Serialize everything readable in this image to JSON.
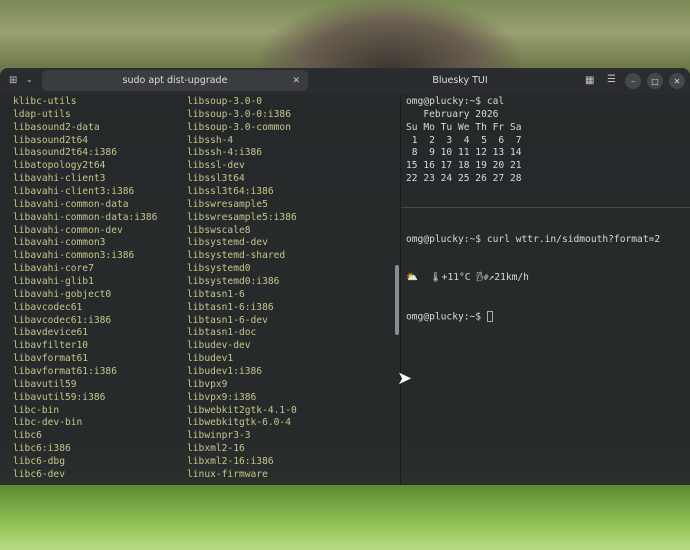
{
  "window": {
    "tab_title": "sudo apt dist-upgrade",
    "title": "Bluesky TUI"
  },
  "left_col1": [
    "klibc-utils",
    "ldap-utils",
    "libasound2-data",
    "libasound2t64",
    "libasound2t64:i386",
    "libatopology2t64",
    "libavahi-client3",
    "libavahi-client3:i386",
    "libavahi-common-data",
    "libavahi-common-data:i386",
    "libavahi-common-dev",
    "libavahi-common3",
    "libavahi-common3:i386",
    "libavahi-core7",
    "libavahi-glib1",
    "libavahi-gobject0",
    "libavcodec61",
    "libavcodec61:i386",
    "libavdevice61",
    "libavfilter10",
    "libavformat61",
    "libavformat61:i386",
    "libavutil59",
    "libavutil59:i386",
    "libc-bin",
    "libc-dev-bin",
    "libc6",
    "libc6:i386",
    "libc6-dbg",
    "libc6-dev"
  ],
  "left_col2": [
    "libsoup-3.0-0",
    "libsoup-3.0-0:i386",
    "libsoup-3.0-common",
    "libssh-4",
    "libssh-4:i386",
    "libssl-dev",
    "libssl3t64",
    "libssl3t64:i386",
    "libswresample5",
    "libswresample5:i386",
    "libswscale8",
    "libsystemd-dev",
    "libsystemd-shared",
    "libsystemd0",
    "libsystemd0:i386",
    "libtasn1-6",
    "libtasn1-6:i386",
    "libtasn1-6-dev",
    "libtasn1-doc",
    "libudev-dev",
    "libudev1",
    "libudev1:i386",
    "libvpx9",
    "libvpx9:i386",
    "libwebkit2gtk-4.1-0",
    "libwebkitgtk-6.0-4",
    "libwinpr3-3",
    "libxml2-16",
    "libxml2-16:i386",
    "linux-firmware"
  ],
  "top_pane": [
    "omg@plucky:~$ cal",
    "   February 2026",
    "Su Mo Tu We Th Fr Sa",
    " 1  2  3  4  5  6  7",
    " 8  9 10 11 12 13 14",
    "15 16 17 18 19 20 21",
    "22 23 24 25 26 27 28"
  ],
  "bottom_pane": {
    "cmd": "omg@plucky:~$ curl wttr.in/sidmouth?format=2",
    "weather": "⛅  🌡+11°C 🌬↗21km/h",
    "prompt": "omg@plucky:~$ "
  }
}
